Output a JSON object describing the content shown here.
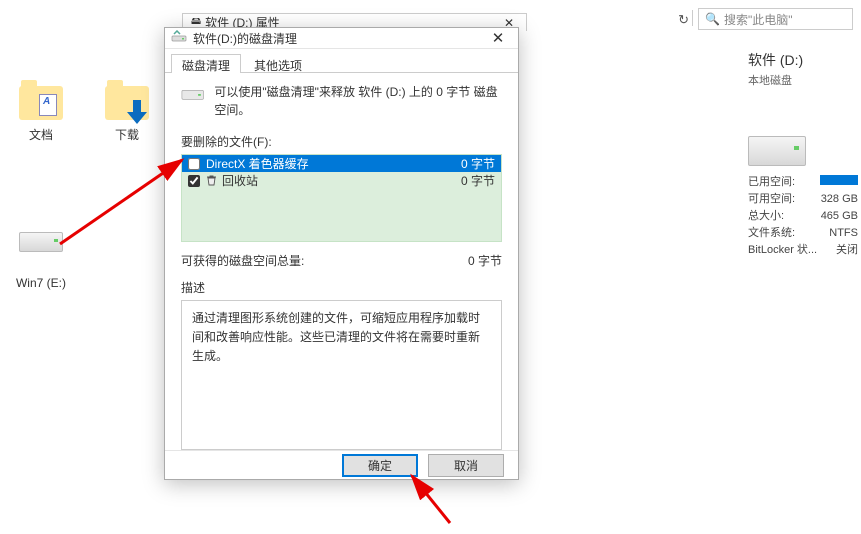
{
  "search": {
    "placeholder": "搜索\"此电脑\""
  },
  "props_dialog": {
    "title": "软件 (D:) 属性"
  },
  "dialog": {
    "title": "软件(D:)的磁盘清理",
    "tabs": {
      "cleanup": "磁盘清理",
      "other": "其他选项"
    },
    "summary": "可以使用\"磁盘清理\"来释放 软件 (D:) 上的 0 字节 磁盘空间。",
    "files_label": "要删除的文件(F):",
    "files": [
      {
        "name": "DirectX 着色器缓存",
        "size": "0 字节",
        "checked": false,
        "selected": true
      },
      {
        "name": "回收站",
        "size": "0 字节",
        "checked": true,
        "selected": false
      }
    ],
    "total_label": "可获得的磁盘空间总量:",
    "total_value": "0 字节",
    "desc_label": "描述",
    "desc_text": "通过清理图形系统创建的文件，可缩短应用程序加载时间和改善响应性能。这些已清理的文件将在需要时重新生成。",
    "ok": "确定",
    "cancel": "取消"
  },
  "icons": {
    "docs": "文档",
    "downloads": "下载",
    "win7": "Win7 (E:)"
  },
  "details": {
    "title": "软件 (D:)",
    "subtitle": "本地磁盘",
    "used_label": "已用空间:",
    "free_label": "可用空间:",
    "free_value": "328 GB",
    "total_label": "总大小:",
    "total_value": "465 GB",
    "fs_label": "文件系统:",
    "fs_value": "NTFS",
    "bitlocker_label": "BitLocker 状...",
    "bitlocker_value": "关闭"
  }
}
